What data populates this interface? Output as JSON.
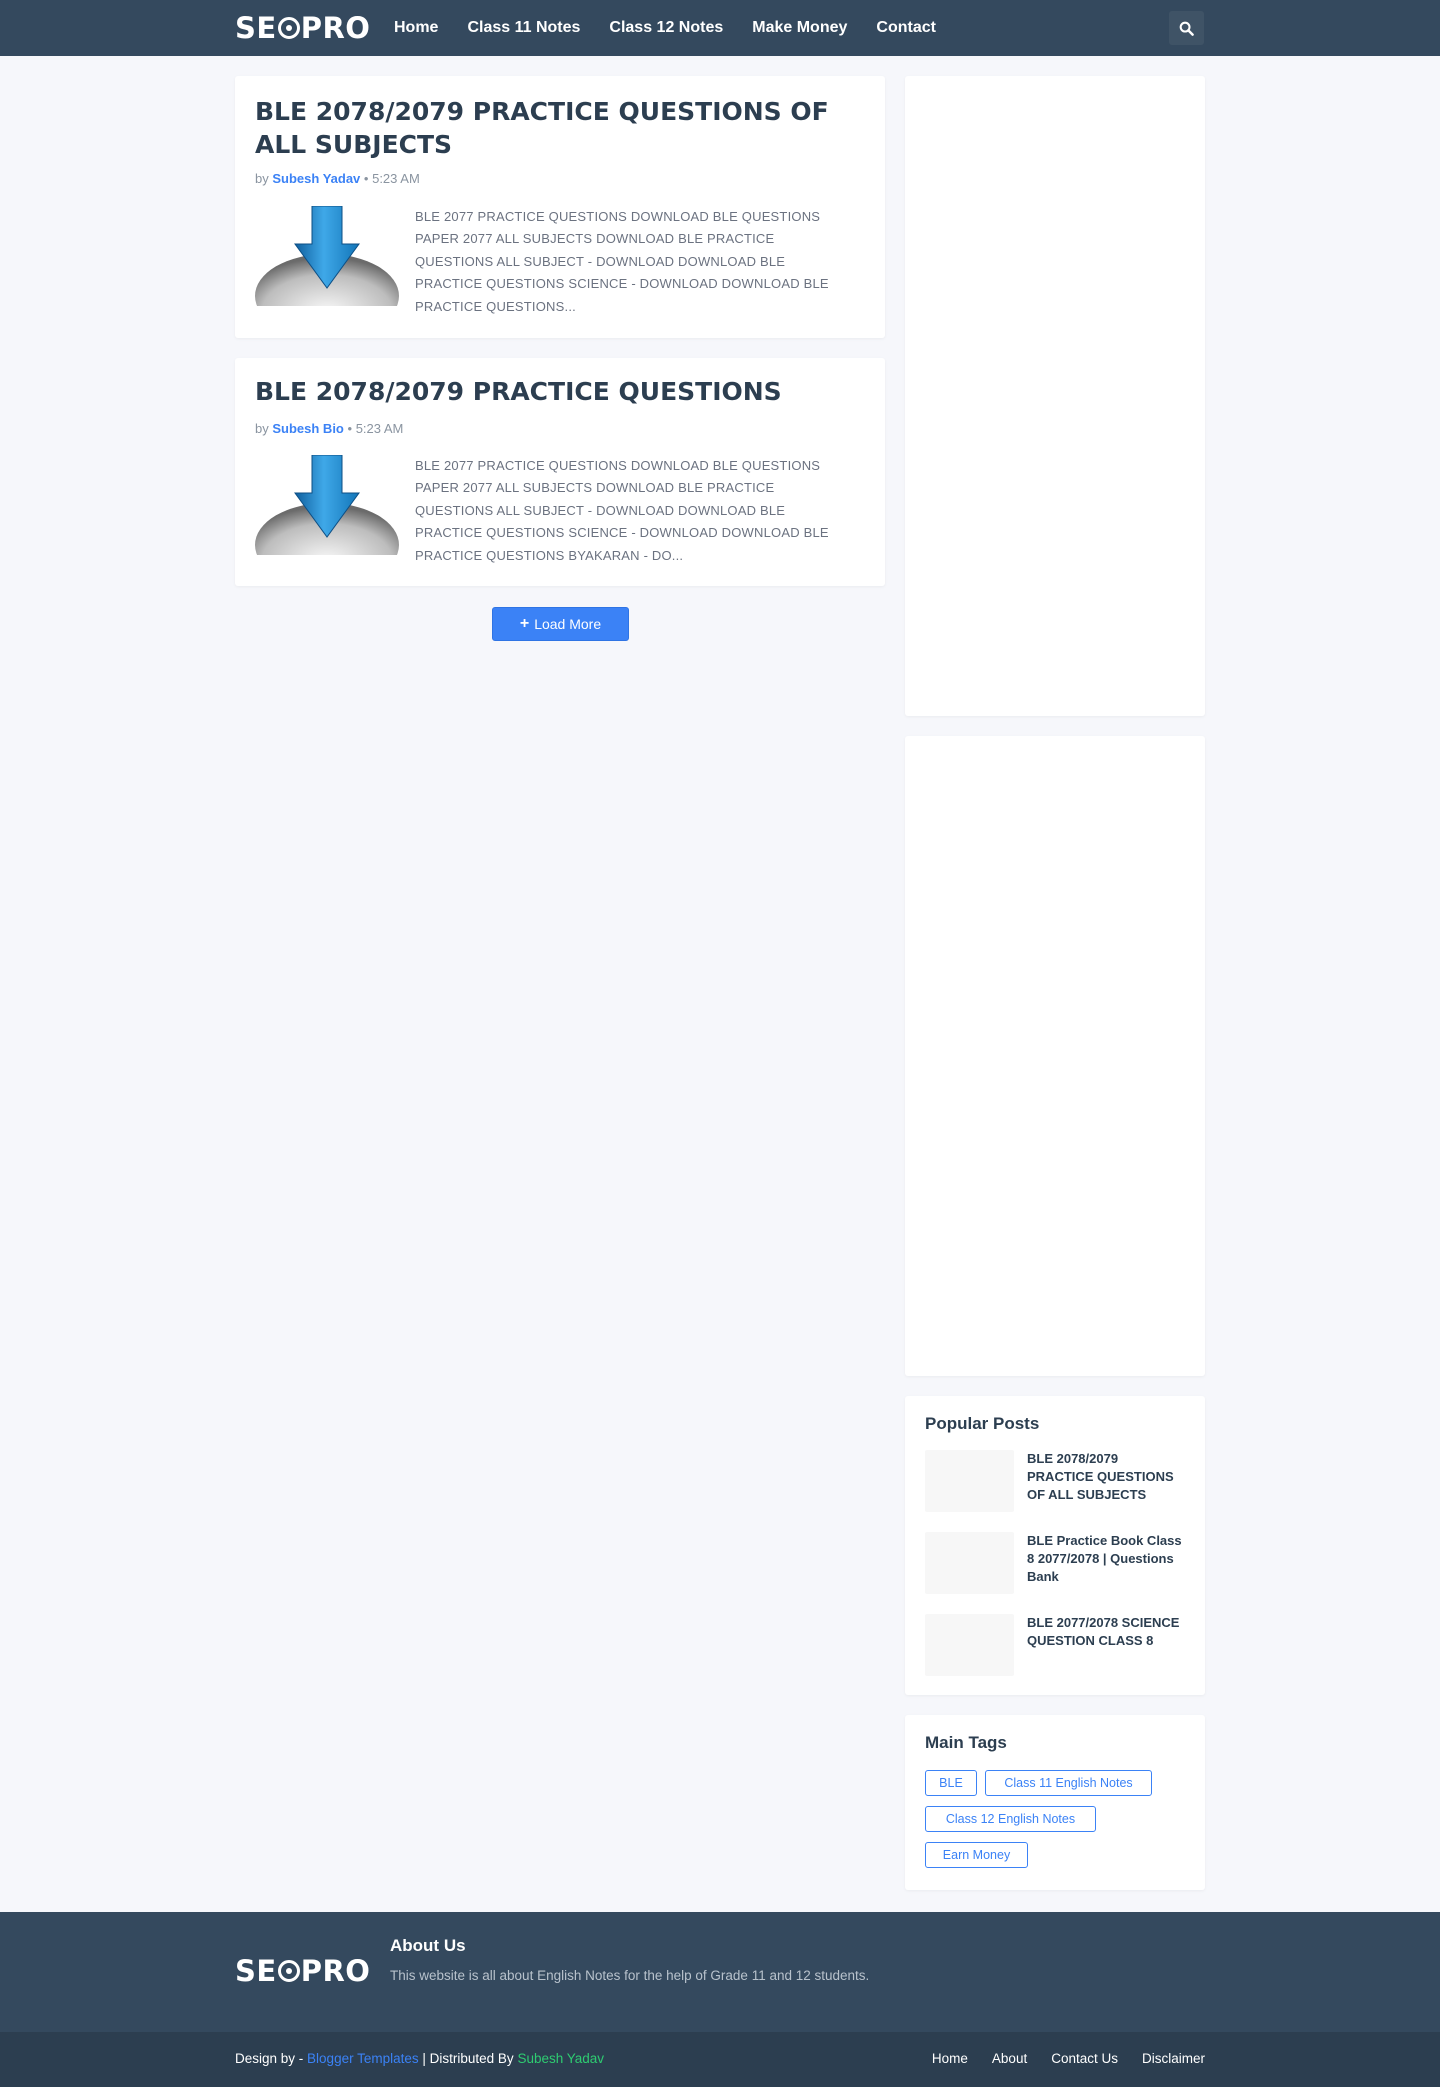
{
  "header": {
    "logo_left": "SE",
    "logo_right": "PRO",
    "nav": [
      "Home",
      "Class 11 Notes",
      "Class 12 Notes",
      "Make Money",
      "Contact"
    ]
  },
  "posts": [
    {
      "title": "BLE 2078/2079 PRACTICE QUESTIONS OF ALL SUBJECTS",
      "by": "by",
      "author": "Subesh Yadav",
      "time": "5:23 AM",
      "snippet": "BLE 2077 PRACTICE QUESTIONS DOWNLOAD BLE QUESTIONS PAPER 2077 ALL SUBJECTS DOWNLOAD BLE PRACTICE QUESTIONS ALL SUBJECT -  DOWNLOAD DOWNLOAD BLE PRACTICE QUESTIONS SCIENCE -  DOWNLOAD DOWNLOAD BLE PRACTICE QUESTIONS..."
    },
    {
      "title": "BLE 2078/2079 PRACTICE QUESTIONS",
      "by": "by",
      "author": "Subesh Bio",
      "time": "5:23 AM",
      "snippet": "BLE 2077 PRACTICE QUESTIONS DOWNLOAD BLE QUESTIONS PAPER 2077 ALL SUBJECTS DOWNLOAD BLE PRACTICE QUESTIONS ALL SUBJECT -  DOWNLOAD DOWNLOAD BLE PRACTICE QUESTIONS SCIENCE -  DOWNLOAD DOWNLOAD BLE PRACTICE QUESTIONS BYAKARAN -  DO..."
    }
  ],
  "load_more": "Load More",
  "popular": {
    "title": "Popular Posts",
    "items": [
      "BLE 2078/2079 PRACTICE QUESTIONS OF ALL SUBJECTS",
      "BLE Practice Book Class 8 2077/2078 | Questions Bank",
      "BLE 2077/2078 SCIENCE QUESTION CLASS 8"
    ]
  },
  "tags": {
    "title": "Main Tags",
    "items": [
      "BLE",
      "Class 11 English Notes",
      "Class 12 English Notes",
      "Earn Money"
    ]
  },
  "footer": {
    "about_title": "About Us",
    "about_text": "This website is all about English Notes for the help of Grade 11 and 12 students.",
    "design_by": "Design by -",
    "design_link": "Blogger Templates",
    "separator": "| Distributed By",
    "dist_link": "Subesh Yadav",
    "nav": [
      "Home",
      "About",
      "Contact Us",
      "Disclaimer"
    ]
  }
}
